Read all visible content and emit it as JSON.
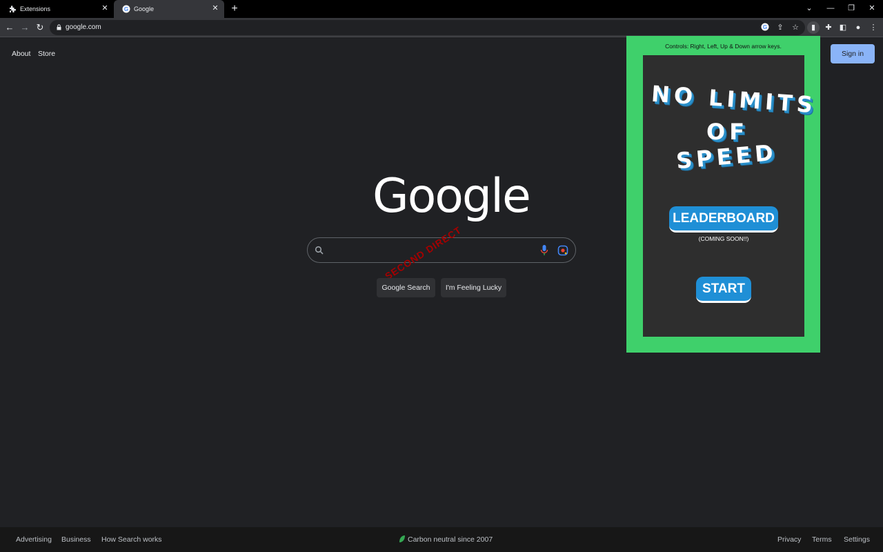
{
  "browser": {
    "tabs": [
      {
        "label": "Extensions",
        "icon": "puzzle-icon"
      },
      {
        "label": "Google",
        "icon": "google-favicon"
      }
    ],
    "url": "google.com"
  },
  "google": {
    "top_links": [
      "About",
      "Store"
    ],
    "sign_in": "Sign in",
    "logo": "Google",
    "search_button": "Google Search",
    "lucky_button": "I'm Feeling Lucky",
    "watermark": "SECOND DIRECT"
  },
  "footer": {
    "left": [
      "Advertising",
      "Business",
      "How Search works"
    ],
    "center": "Carbon neutral since 2007",
    "right": [
      "Privacy",
      "Terms",
      "Settings"
    ]
  },
  "popup": {
    "controls": "Controls: Right, Left, Up & Down arrow keys.",
    "title_line1": "NO LIMITS",
    "title_line2": "OF",
    "title_line3": "SPEED",
    "leaderboard": "LEADERBOARD",
    "coming_soon": "(COMING SOON!!)",
    "start": "START"
  },
  "colors": {
    "page_bg": "#202124",
    "popup_border": "#3fd06b",
    "game_bg": "#2e2e2e",
    "button_blue": "#1f8fd6",
    "signin_bg": "#8ab4f8"
  }
}
